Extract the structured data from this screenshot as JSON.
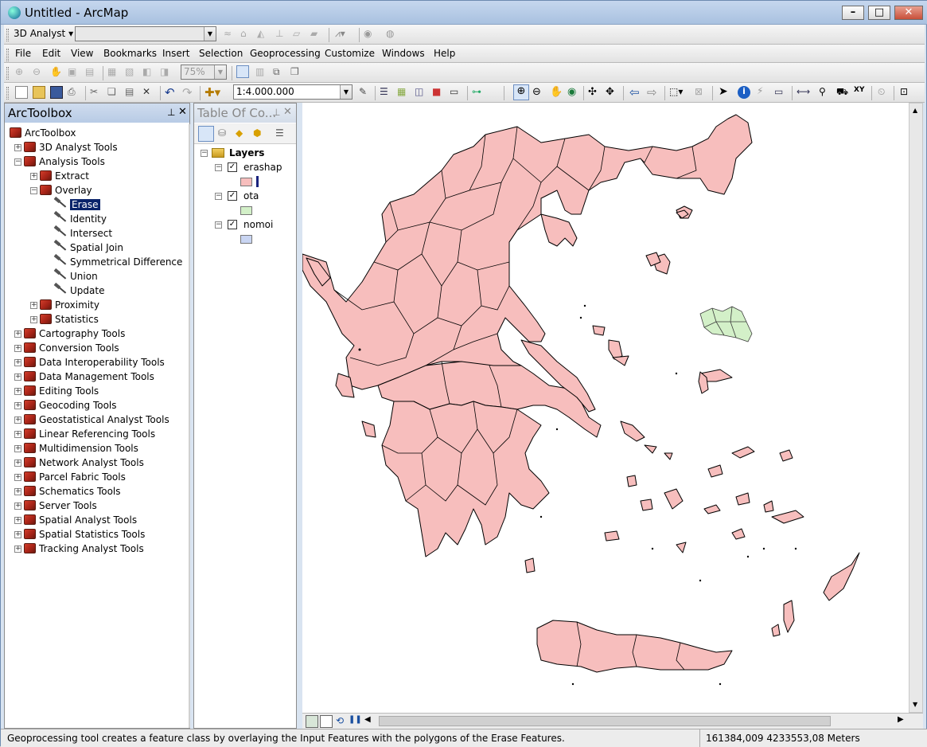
{
  "window": {
    "title": "Untitled - ArcMap"
  },
  "toolbar_3d": {
    "label": "3D Analyst",
    "layer_combo": ""
  },
  "menu": [
    "File",
    "Edit",
    "View",
    "Bookmarks",
    "Insert",
    "Selection",
    "Geoprocessing",
    "Customize",
    "Windows",
    "Help"
  ],
  "zoom_combo": "75%",
  "scale_combo": "1:4.000.000",
  "arctoolbox": {
    "title": "ArcToolbox",
    "pin": "ᵖ",
    "root": "ArcToolbox",
    "toolboxes": [
      "3D Analyst Tools",
      "Analysis Tools",
      "Cartography Tools",
      "Conversion Tools",
      "Data Interoperability Tools",
      "Data Management Tools",
      "Editing Tools",
      "Geocoding Tools",
      "Geostatistical Analyst Tools",
      "Linear Referencing Tools",
      "Multidimension Tools",
      "Network Analyst Tools",
      "Parcel Fabric Tools",
      "Schematics Tools",
      "Server Tools",
      "Spatial Analyst Tools",
      "Spatial Statistics Tools",
      "Tracking Analyst Tools"
    ],
    "analysis_children": [
      "Extract",
      "Overlay",
      "Proximity",
      "Statistics"
    ],
    "overlay_tools": [
      "Erase",
      "Identity",
      "Intersect",
      "Spatial Join",
      "Symmetrical Difference",
      "Union",
      "Update"
    ],
    "selected_tool": "Erase"
  },
  "toc": {
    "title": "Table Of Co...",
    "root": "Layers",
    "layers": [
      {
        "name": "erashap",
        "checked": true,
        "color": "#f7bebd"
      },
      {
        "name": "ota",
        "checked": true,
        "color": "#d3f0c8"
      },
      {
        "name": "nomoi",
        "checked": true,
        "color": "#c9d5f2"
      }
    ]
  },
  "status": {
    "message": "Geoprocessing tool creates a feature class by overlaying the Input Features with the polygons of the Erase Features.",
    "coords": "161384,009  4233553,08 Meters"
  }
}
